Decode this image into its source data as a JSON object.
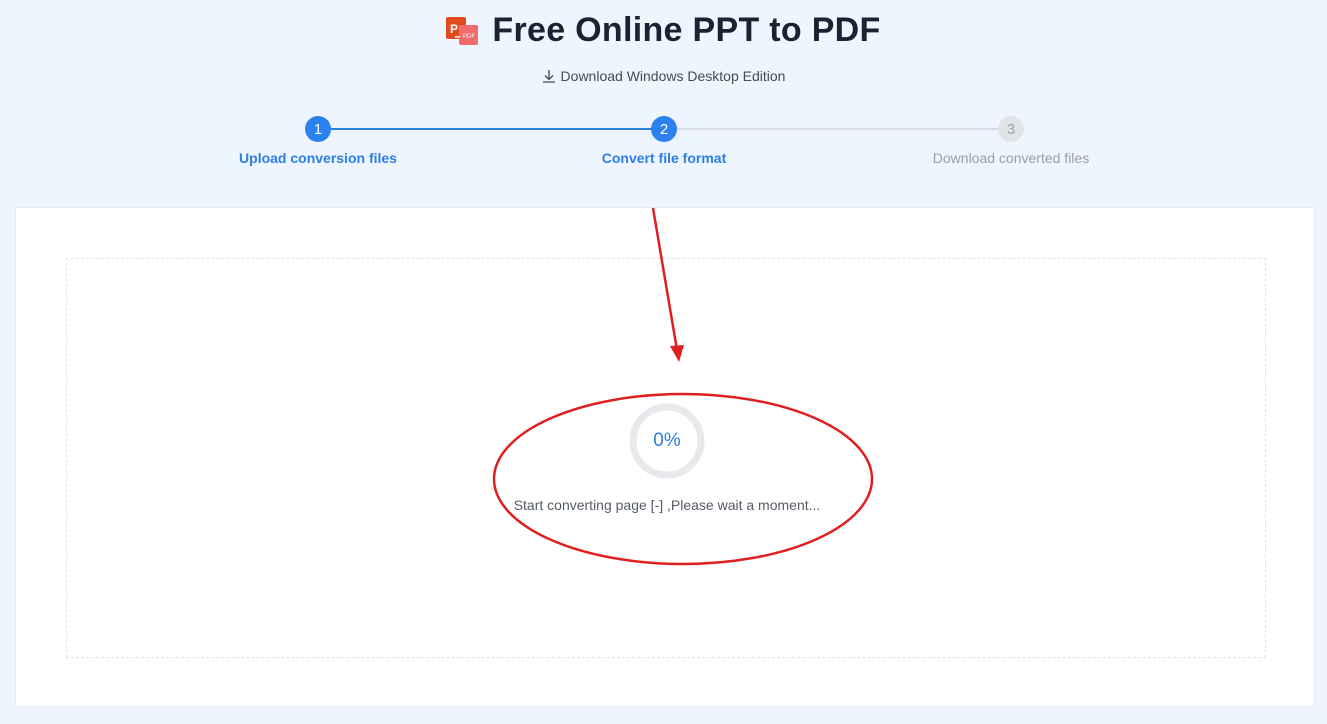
{
  "header": {
    "title": "Free Online PPT to PDF",
    "download_label": "Download Windows Desktop Edition"
  },
  "steps": [
    {
      "number": "1",
      "label": "Upload conversion files",
      "state": "done"
    },
    {
      "number": "2",
      "label": "Convert file format",
      "state": "active"
    },
    {
      "number": "3",
      "label": "Download converted files",
      "state": "pending"
    }
  ],
  "conversion": {
    "progress_label": "0%",
    "progress_percent": 0,
    "status": "Start converting page [-] ,Please wait a moment..."
  },
  "colors": {
    "accent": "#2b82ee",
    "annotation": "#e02020",
    "background": "#eef5fe"
  },
  "icons": {
    "logo": "ppt-to-pdf-logo-icon",
    "download": "download-icon"
  }
}
